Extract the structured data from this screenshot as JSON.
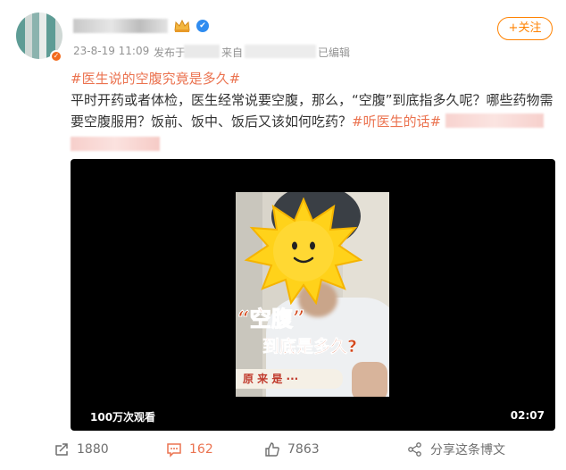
{
  "post": {
    "timestamp": "23-8-19 11:09",
    "source_label": "发布于",
    "from_label": "来自",
    "edited_label": "已编辑",
    "follow_button": "+关注",
    "topic_title": "#医生说的空腹究竟是多久#",
    "content_text": "平时开药或者体检，医生经常说要空腹，那么，“空腹”到底指多久呢？哪些药物需要空腹服用？饭前、饭中、饭后又该如何吃药？",
    "content_hashtag": "#听医生的话#"
  },
  "video": {
    "overlay_title_1": "“空腹”",
    "overlay_title_2": "到底是多久?",
    "overlay_caption": "原 来 是 ···",
    "views": "100万次观看",
    "duration": "02:07"
  },
  "actions": {
    "repost_count": "1880",
    "comment_count": "162",
    "like_count": "7863",
    "share_label": "分享这条博文"
  },
  "colors": {
    "accent": "#ff8200",
    "topic": "#eb7350",
    "meta": "#939393"
  },
  "icons": [
    "avatar",
    "crown-icon",
    "verified-icon",
    "repost-icon",
    "comment-icon",
    "like-icon",
    "share-icon"
  ]
}
